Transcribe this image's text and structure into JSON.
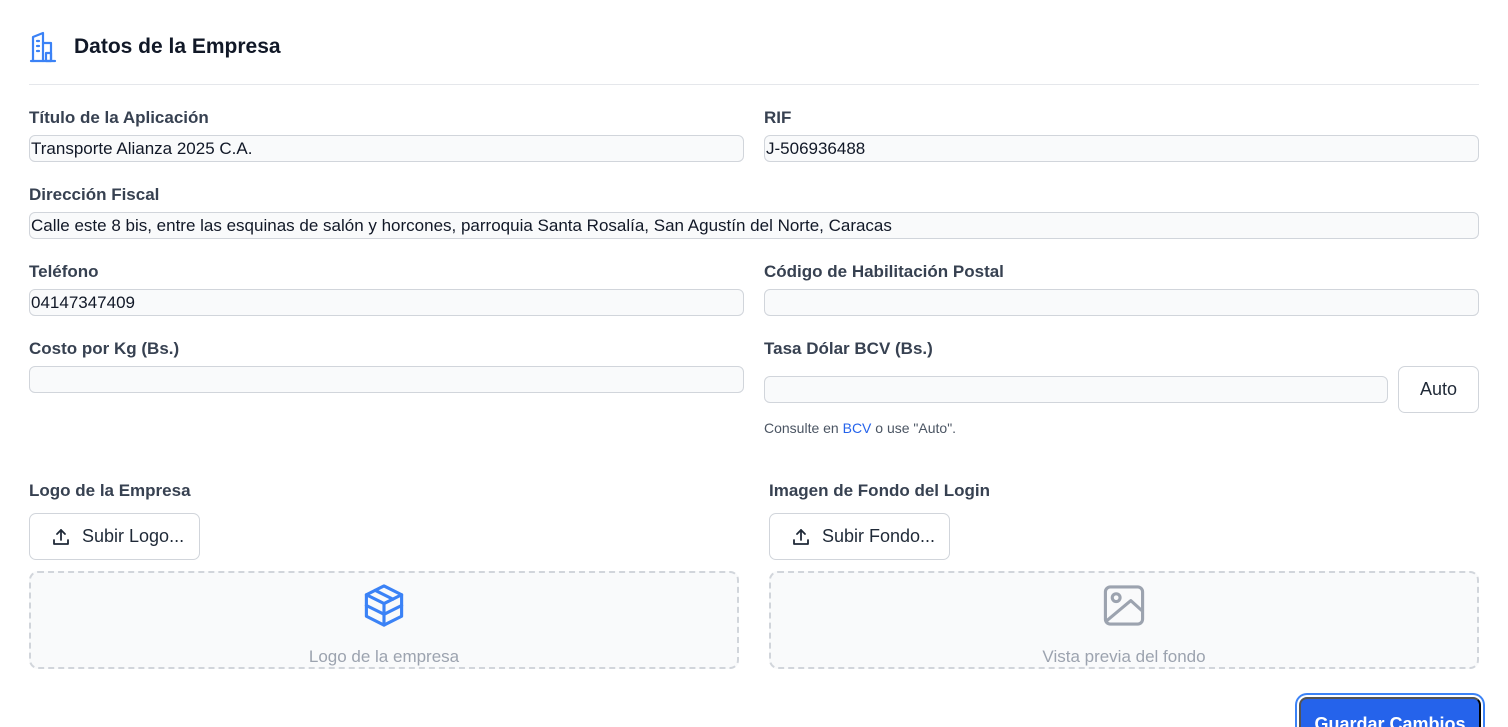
{
  "section": {
    "title": "Datos de la Empresa",
    "icon": "building-icon"
  },
  "fields": {
    "app_title": {
      "label": "Título de la Aplicación",
      "value": "Transporte Alianza 2025 C.A."
    },
    "rif": {
      "label": "RIF",
      "value": "J-506936488"
    },
    "address": {
      "label": "Dirección Fiscal",
      "value": "Calle este 8 bis, entre las esquinas de salón y horcones, parroquia Santa Rosalía, San Agustín del Norte, Caracas"
    },
    "phone": {
      "label": "Teléfono",
      "value": "04147347409"
    },
    "postal_code": {
      "label": "Código de Habilitación Postal",
      "value": ""
    },
    "cost_per_kg": {
      "label": "Costo por Kg (Bs.)",
      "value": ""
    },
    "bcv_rate": {
      "label": "Tasa Dólar BCV (Bs.)",
      "value": ""
    }
  },
  "auto_button": "Auto",
  "help": {
    "prefix": "Consulte en ",
    "link": "BCV",
    "suffix": " o use \"Auto\"."
  },
  "logo": {
    "label": "Logo de la Empresa",
    "button": "Subir Logo...",
    "placeholder": "Logo de la empresa"
  },
  "background": {
    "label": "Imagen de Fondo del Login",
    "button": "Subir Fondo...",
    "placeholder": "Vista previa del fondo"
  },
  "save_button": "Guardar Cambios",
  "colors": {
    "accent": "#2563eb",
    "icon_blue": "#3b82f6",
    "muted": "#9ca3af"
  }
}
